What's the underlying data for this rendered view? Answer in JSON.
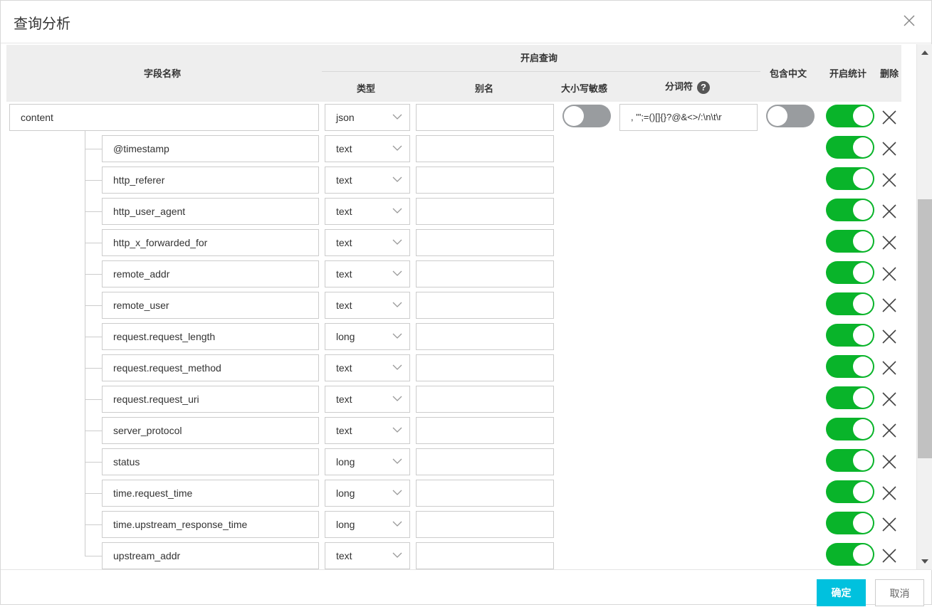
{
  "dialog": {
    "title": "查询分析"
  },
  "header": {
    "field_name": "字段名称",
    "enable_query": "开启查询",
    "type": "类型",
    "alias": "别名",
    "case_sensitive": "大小写敏感",
    "tokenizer": "分词符",
    "help": "?",
    "include_chinese": "包含中文",
    "enable_stats": "开启统计",
    "delete": "删除"
  },
  "root": {
    "name": "content",
    "type": "json",
    "alias": "",
    "case_sensitive": false,
    "tokenizer": ", '\";=()[]{}?@&<>/:\\n\\t\\r",
    "include_chinese": false,
    "enable_stats": true
  },
  "fields": [
    {
      "name": "@timestamp",
      "type": "text",
      "alias": "",
      "enable_stats": true
    },
    {
      "name": "http_referer",
      "type": "text",
      "alias": "",
      "enable_stats": true
    },
    {
      "name": "http_user_agent",
      "type": "text",
      "alias": "",
      "enable_stats": true
    },
    {
      "name": "http_x_forwarded_for",
      "type": "text",
      "alias": "",
      "enable_stats": true
    },
    {
      "name": "remote_addr",
      "type": "text",
      "alias": "",
      "enable_stats": true
    },
    {
      "name": "remote_user",
      "type": "text",
      "alias": "",
      "enable_stats": true
    },
    {
      "name": "request.request_length",
      "type": "long",
      "alias": "",
      "enable_stats": true
    },
    {
      "name": "request.request_method",
      "type": "text",
      "alias": "",
      "enable_stats": true
    },
    {
      "name": "request.request_uri",
      "type": "text",
      "alias": "",
      "enable_stats": true
    },
    {
      "name": "server_protocol",
      "type": "text",
      "alias": "",
      "enable_stats": true
    },
    {
      "name": "status",
      "type": "long",
      "alias": "",
      "enable_stats": true
    },
    {
      "name": "time.request_time",
      "type": "long",
      "alias": "",
      "enable_stats": true
    },
    {
      "name": "time.upstream_response_time",
      "type": "long",
      "alias": "",
      "enable_stats": true
    },
    {
      "name": "upstream_addr",
      "type": "text",
      "alias": "",
      "enable_stats": true
    }
  ],
  "footer": {
    "confirm": "确定",
    "cancel": "取消"
  },
  "colors": {
    "toggle_on": "#09b42a",
    "toggle_off": "#999c9f",
    "primary": "#00c1de"
  }
}
